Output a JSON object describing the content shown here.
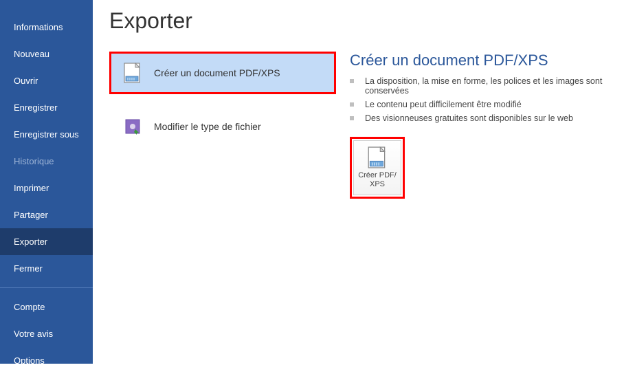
{
  "sidebar": {
    "top": [
      {
        "label": "Informations"
      },
      {
        "label": "Nouveau"
      },
      {
        "label": "Ouvrir"
      },
      {
        "label": "Enregistrer"
      },
      {
        "label": "Enregistrer sous"
      },
      {
        "label": "Historique"
      },
      {
        "label": "Imprimer"
      },
      {
        "label": "Partager"
      },
      {
        "label": "Exporter"
      },
      {
        "label": "Fermer"
      }
    ],
    "bottom": [
      {
        "label": "Compte"
      },
      {
        "label": "Votre avis"
      },
      {
        "label": "Options"
      }
    ]
  },
  "main": {
    "heading": "Exporter",
    "options": {
      "createPdfXps": "Créer un document PDF/XPS",
      "changeFileType": "Modifier le type de fichier"
    },
    "detail": {
      "heading": "Créer un document PDF/XPS",
      "bullets": [
        "La disposition, la mise en forme, les polices et les images sont conservées",
        "Le contenu peut difficilement être modifié",
        "Des visionneuses gratuites sont disponibles sur le web"
      ],
      "button_line1": "Créer PDF/",
      "button_line2": "XPS"
    }
  }
}
